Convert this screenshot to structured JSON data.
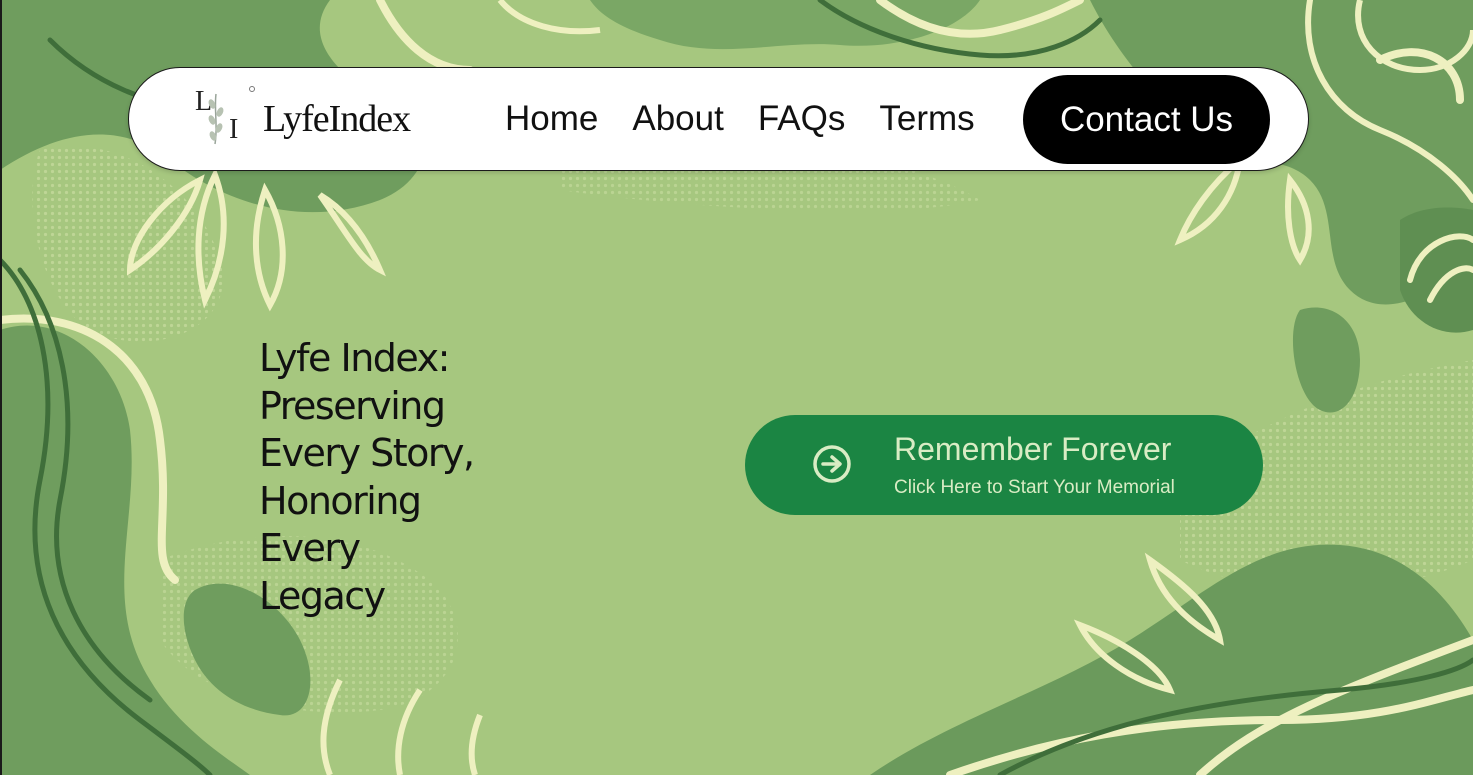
{
  "brand": {
    "logo_letter_top": "L",
    "logo_letter_bottom": "I",
    "name": "LyfeIndex"
  },
  "nav": {
    "items": [
      {
        "label": "Home"
      },
      {
        "label": "About"
      },
      {
        "label": "FAQs"
      },
      {
        "label": "Terms"
      }
    ],
    "contact_label": "Contact Us"
  },
  "hero": {
    "title_lines": [
      "Lyfe Index:",
      "Preserving",
      "Every Story,",
      "Honoring",
      "Every",
      "Legacy"
    ]
  },
  "cta": {
    "title": "Remember Forever",
    "subtitle": "Click Here to Start Your Memorial",
    "icon": "arrow-right-circle-icon"
  },
  "colors": {
    "background": "#a6c77f",
    "background_dark": "#6b9a5c",
    "accent_cream": "#f2f0c4",
    "cta_green": "#1b8543",
    "contact_button": "#000000",
    "navbar": "#ffffff"
  }
}
